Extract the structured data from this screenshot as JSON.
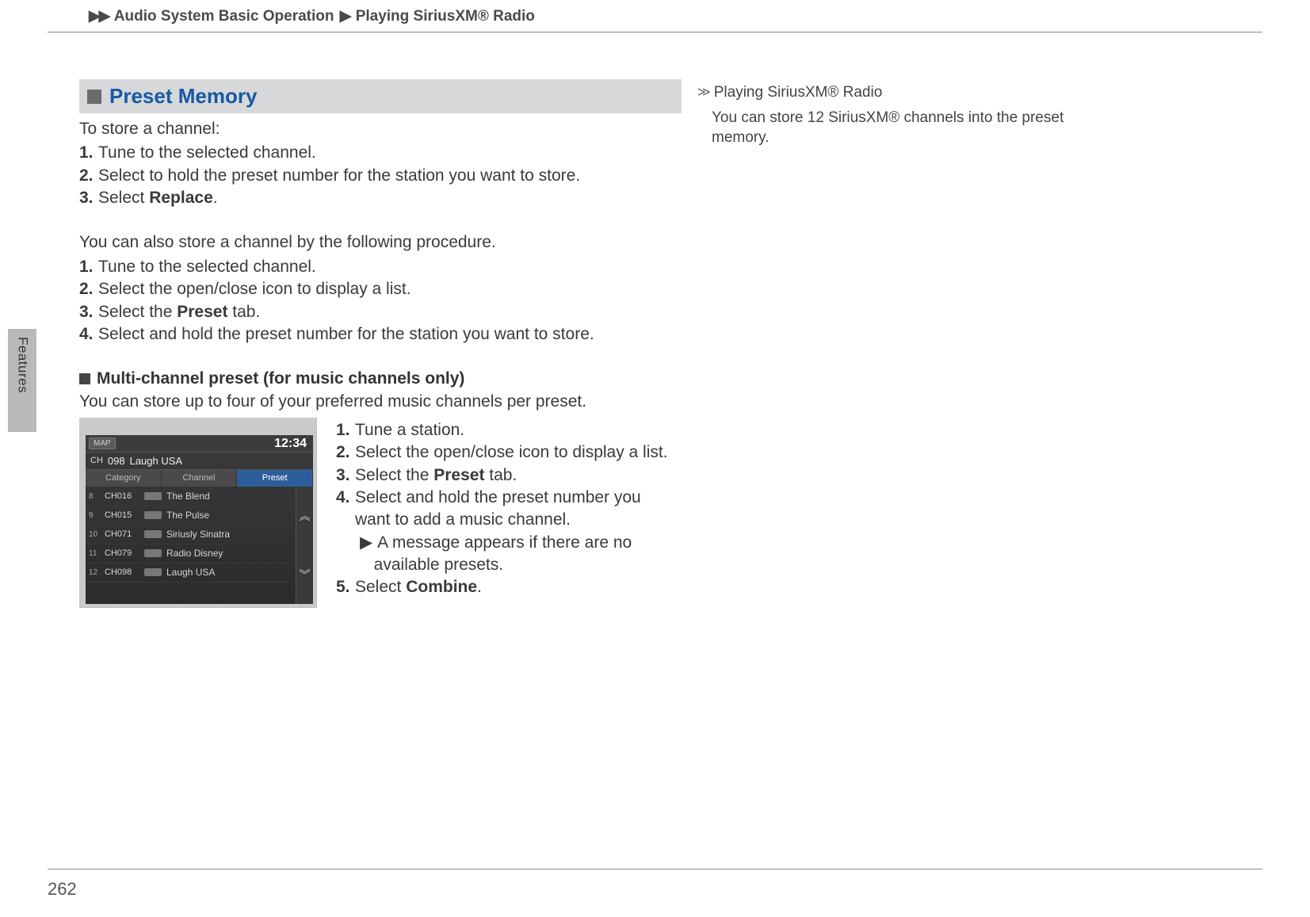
{
  "breadcrumb": {
    "item1": "Audio System Basic Operation",
    "item2": "Playing SiriusXM® Radio"
  },
  "section": {
    "title": "Preset Memory",
    "intro": "To store a channel:",
    "steps1": [
      "Tune to the selected channel.",
      "Select to hold the preset number for the station you want to store.",
      "Select "
    ],
    "step1_3_bold": "Replace",
    "step1_3_after": ".",
    "intro2": "You can also store a channel by the following procedure.",
    "steps2": [
      "Tune to the selected channel.",
      "Select the open/close icon to display a list.",
      "Select the ",
      "Select and hold the preset number for the station you want to store."
    ],
    "step2_3_bold": "Preset",
    "step2_3_after": " tab."
  },
  "subsection": {
    "title": "Multi-channel preset (for music channels only)",
    "intro": "You can store up to four of your preferred music channels per preset.",
    "steps": {
      "s1": "Tune a station.",
      "s2": "Select the open/close icon to display a list.",
      "s3_pre": "Select the ",
      "s3_bold": "Preset",
      "s3_post": " tab.",
      "s4a": "Select and hold the preset number you",
      "s4b": "want to add a music channel.",
      "s4_note_a": "A message appears if there are no",
      "s4_note_b": "available presets.",
      "s5_pre": "Select ",
      "s5_bold": "Combine",
      "s5_post": "."
    }
  },
  "screenshot": {
    "map": "MAP",
    "clock": "12:34",
    "now_ch_prefix": "CH",
    "now_ch": "098",
    "now_name": "Laugh USA",
    "tabs": {
      "cat": "Category",
      "chan": "Channel",
      "preset": "Preset"
    },
    "rows": [
      {
        "idx": "8",
        "ch": "CH016",
        "name": "The Blend"
      },
      {
        "idx": "9",
        "ch": "CH015",
        "name": "The Pulse"
      },
      {
        "idx": "10",
        "ch": "CH071",
        "name": "Siriusly Sinatra"
      },
      {
        "idx": "11",
        "ch": "CH079",
        "name": "Radio Disney"
      },
      {
        "idx": "12",
        "ch": "CH098",
        "name": "Laugh USA"
      }
    ]
  },
  "sidebar": {
    "title": "Playing SiriusXM® Radio",
    "body": "You can store 12 SiriusXM® channels into the preset memory."
  },
  "features_tab": "Features",
  "page_number": "262"
}
